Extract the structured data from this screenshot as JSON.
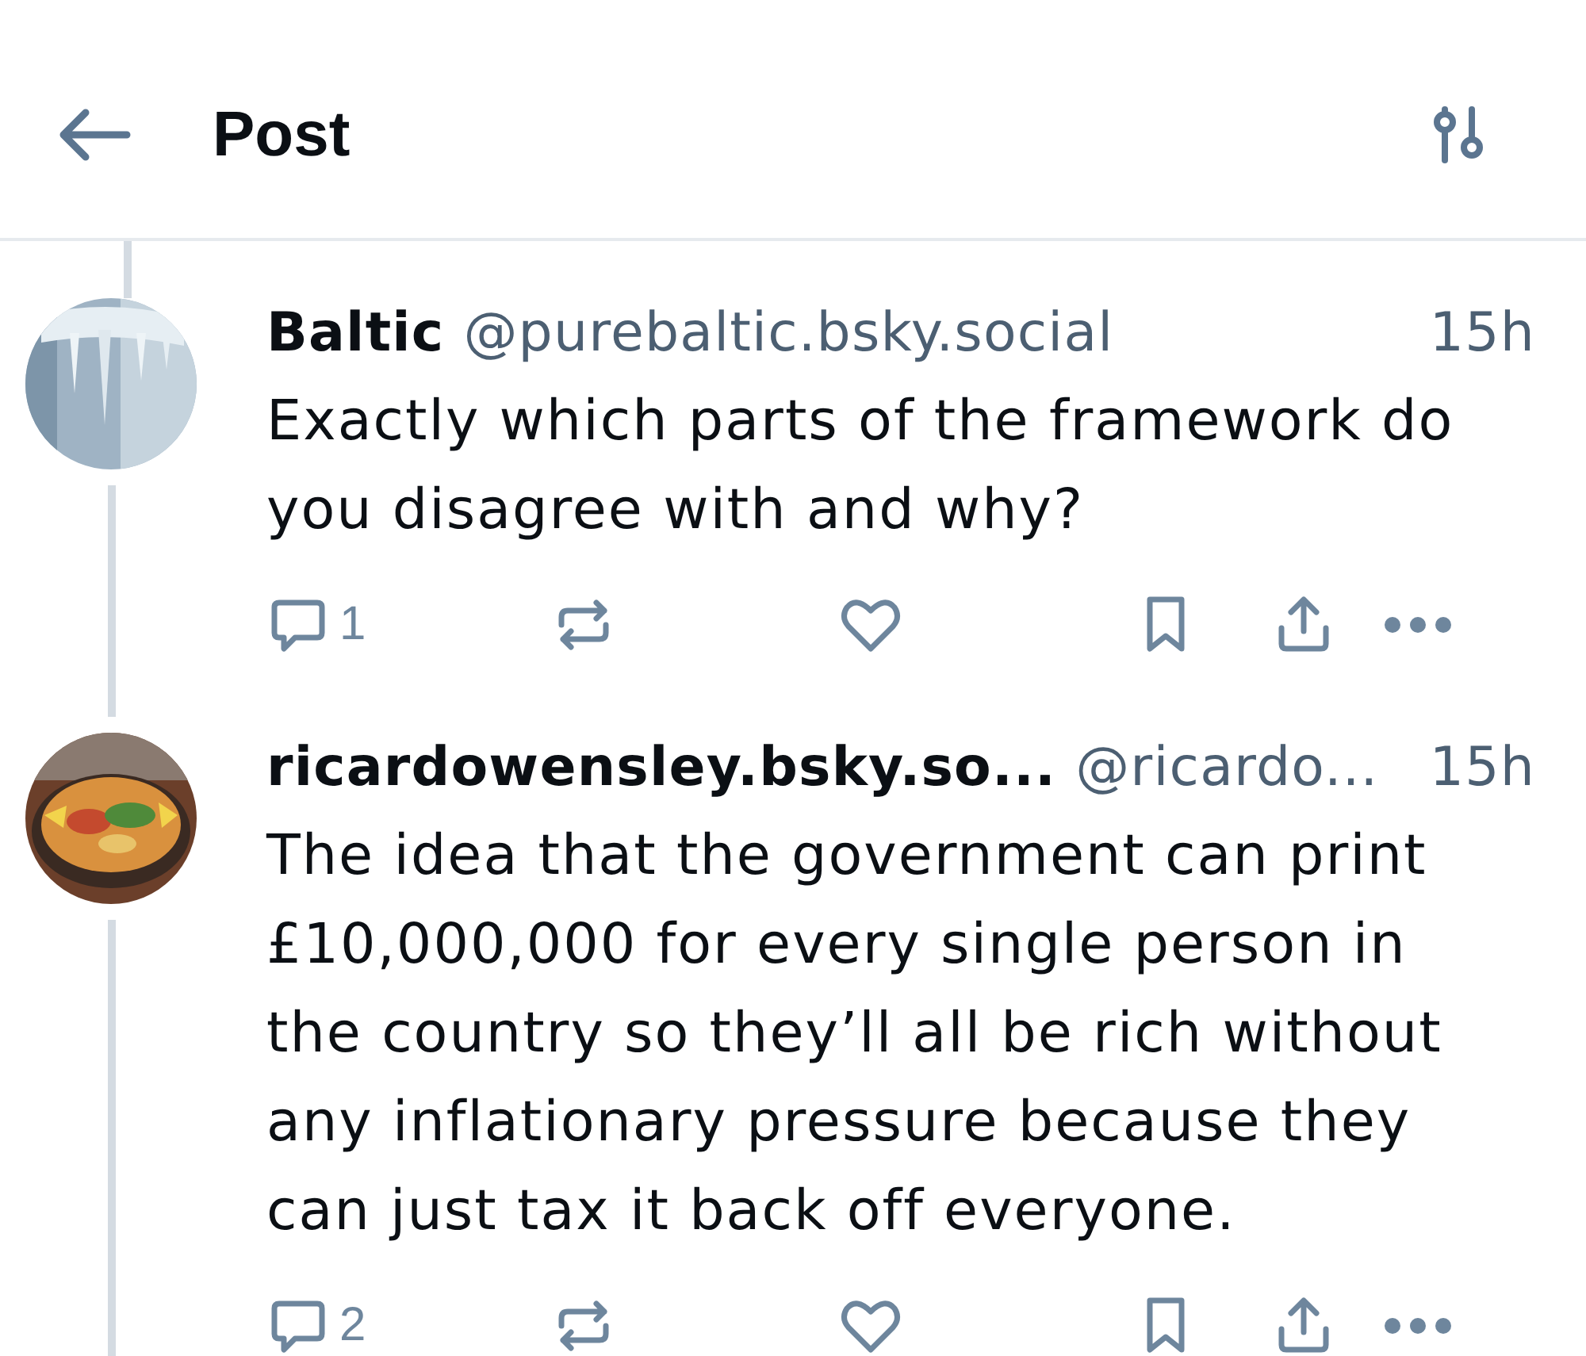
{
  "header": {
    "title": "Post"
  },
  "posts": [
    {
      "name": "Baltic",
      "handle": "@purebaltic.bsky.social",
      "time": "15h",
      "text": "Exactly which parts of the framework do you disagree with and why?",
      "reply_count": "1"
    },
    {
      "name": "ricardowensley.bsky.so...",
      "handle": "@ricardo...",
      "time": "15h",
      "text": "The idea that the government can print £10,000,000 for every single person in the country so they’ll all be rich without any inflationary pressure because they can just tax it back off everyone.",
      "reply_count": "2"
    }
  ]
}
